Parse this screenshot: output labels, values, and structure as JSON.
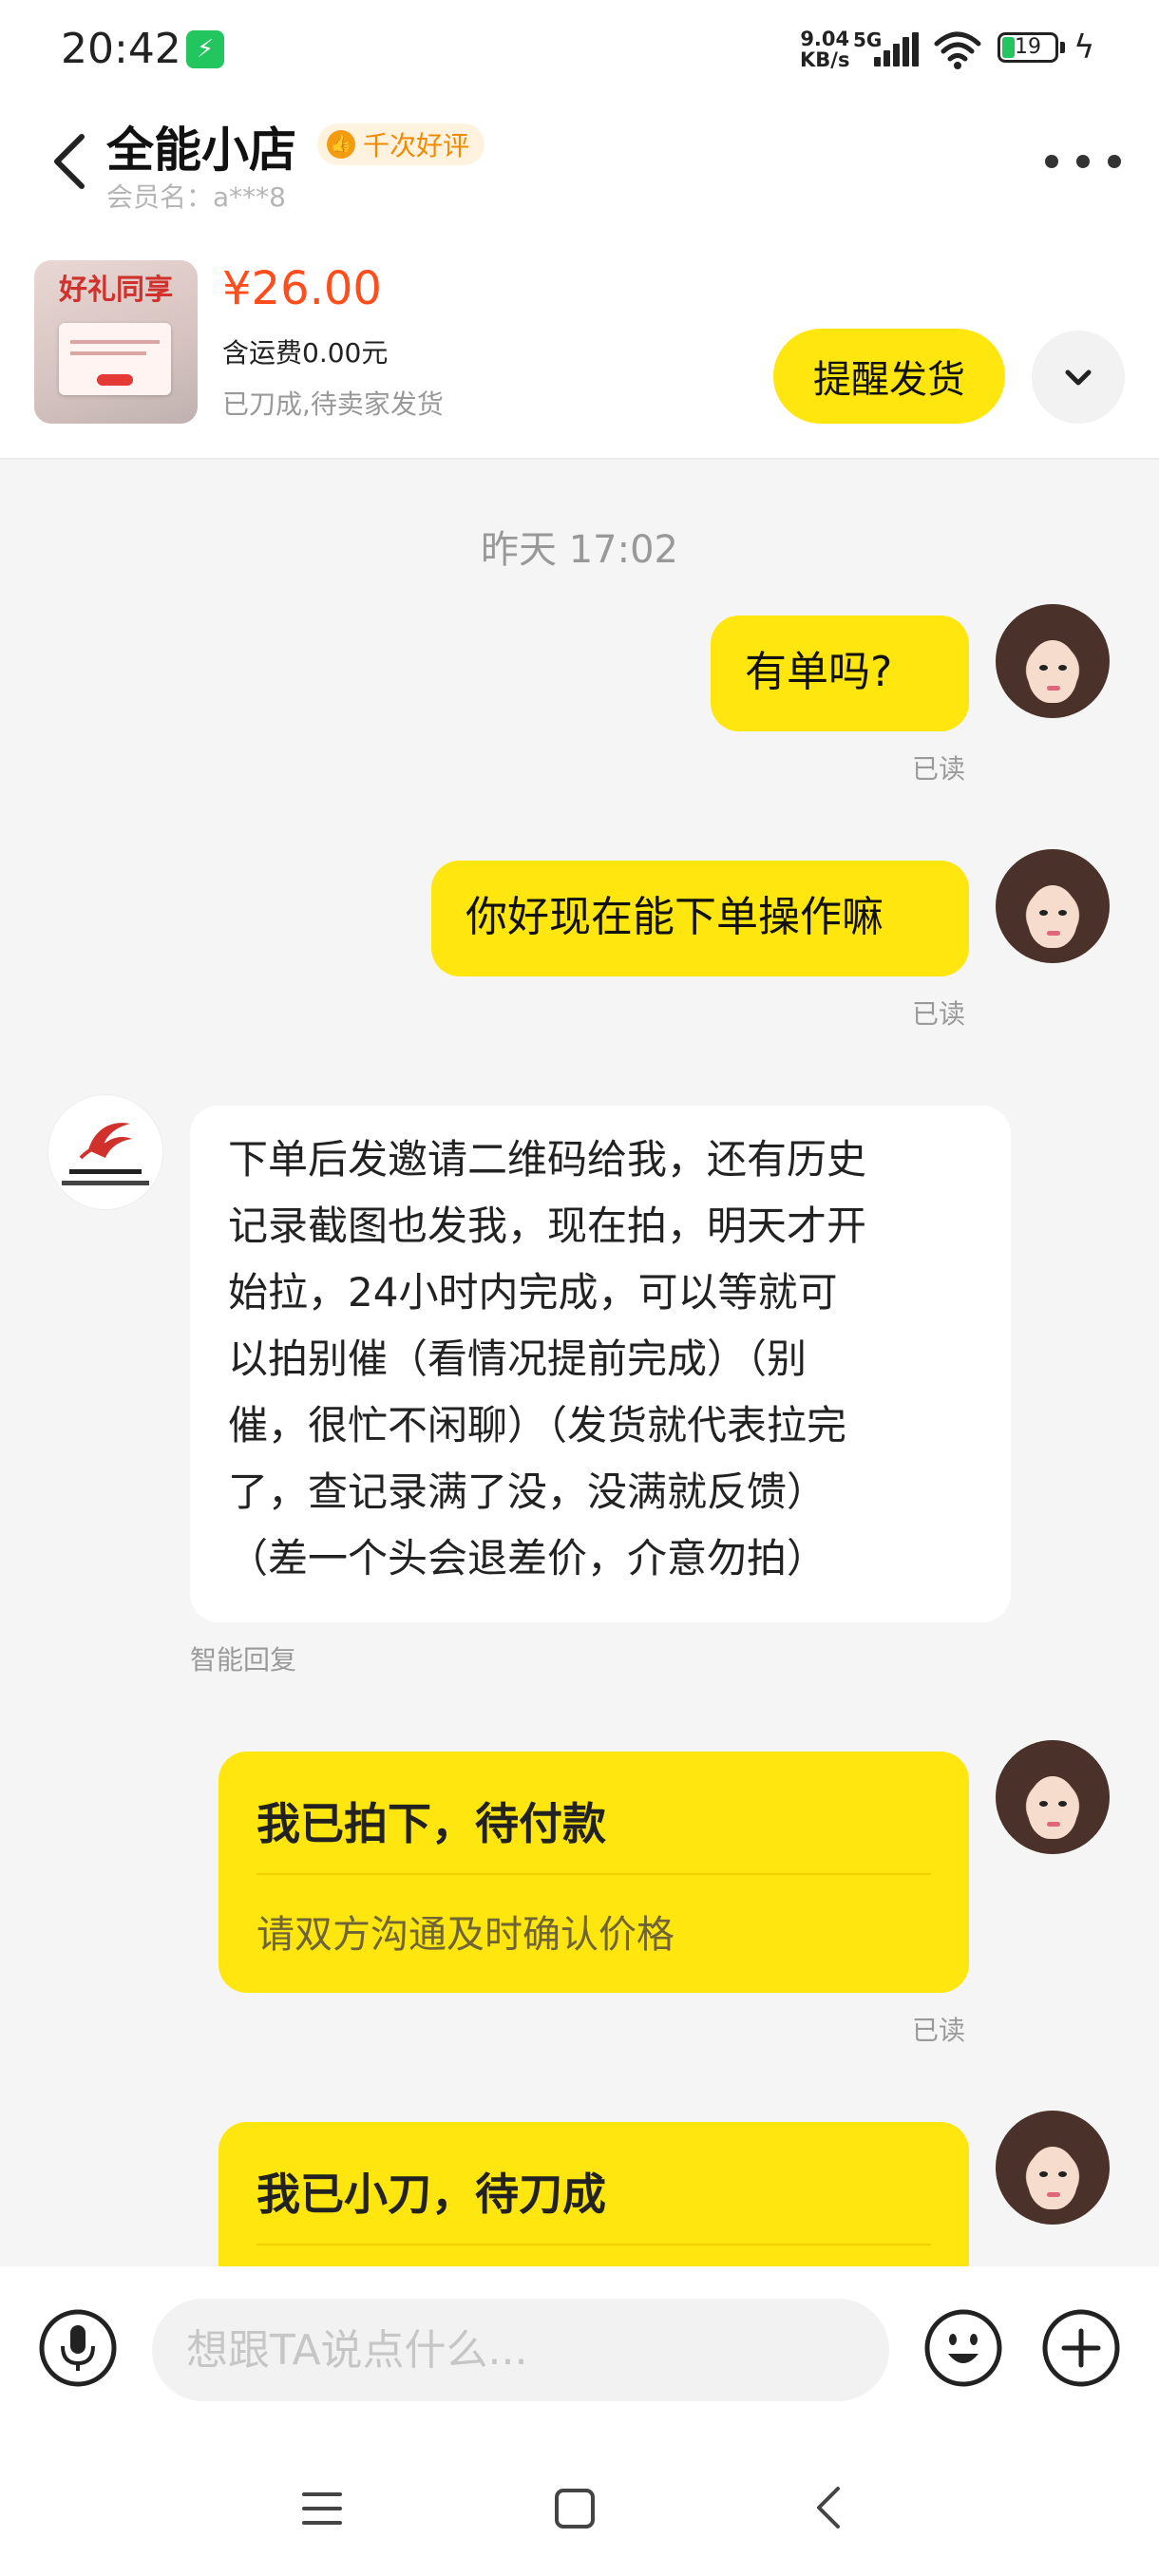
{
  "status_bar": {
    "time": "20:42",
    "net_speed_value": "9.04",
    "net_speed_unit": "KB/s",
    "network": "5G",
    "battery_level": "19",
    "icons": [
      "charging-icon",
      "signal-icon",
      "wifi-icon",
      "battery-icon",
      "bolt-icon"
    ]
  },
  "header": {
    "shop_name": "全能小店",
    "rating_badge": "千次好评",
    "member_label": "会员名：a***8"
  },
  "product": {
    "thumb_banner": "好礼同享",
    "price": "¥26.00",
    "shipping": "含运费0.00元",
    "status": "已刀成,待卖家发货",
    "remind_button": "提醒发货"
  },
  "chat": {
    "timestamp": "昨天 17:02",
    "messages": [
      {
        "from": "me",
        "text": "有单吗?",
        "read": "已读"
      },
      {
        "from": "me",
        "text": "你好现在能下单操作嘛",
        "read": "已读"
      },
      {
        "from": "shop",
        "lines": [
          "下单后发邀请二维码给我，还有历史",
          "记录截图也发我，现在拍，明天才开",
          "始拉，24小时内完成，可以等就可",
          "以拍别催（看情况提前完成）（别",
          "催，很忙不闲聊）（发货就代表拉完",
          "了，查记录满了没，没满就反馈）",
          "（差一个头会退差价，介意勿拍）"
        ],
        "note": "智能回复"
      },
      {
        "from": "me",
        "type": "card",
        "title": "我已拍下，待付款",
        "subtitle": "请双方沟通及时确认价格",
        "read": "已读"
      },
      {
        "from": "me",
        "type": "card",
        "title": "我已小刀，待刀成"
      }
    ]
  },
  "input": {
    "placeholder": "想跟TA说点什么..."
  },
  "colors": {
    "accent_yellow": "#ffe60f",
    "price_orange": "#ff4d1c",
    "badge_orange": "#f08a00"
  }
}
